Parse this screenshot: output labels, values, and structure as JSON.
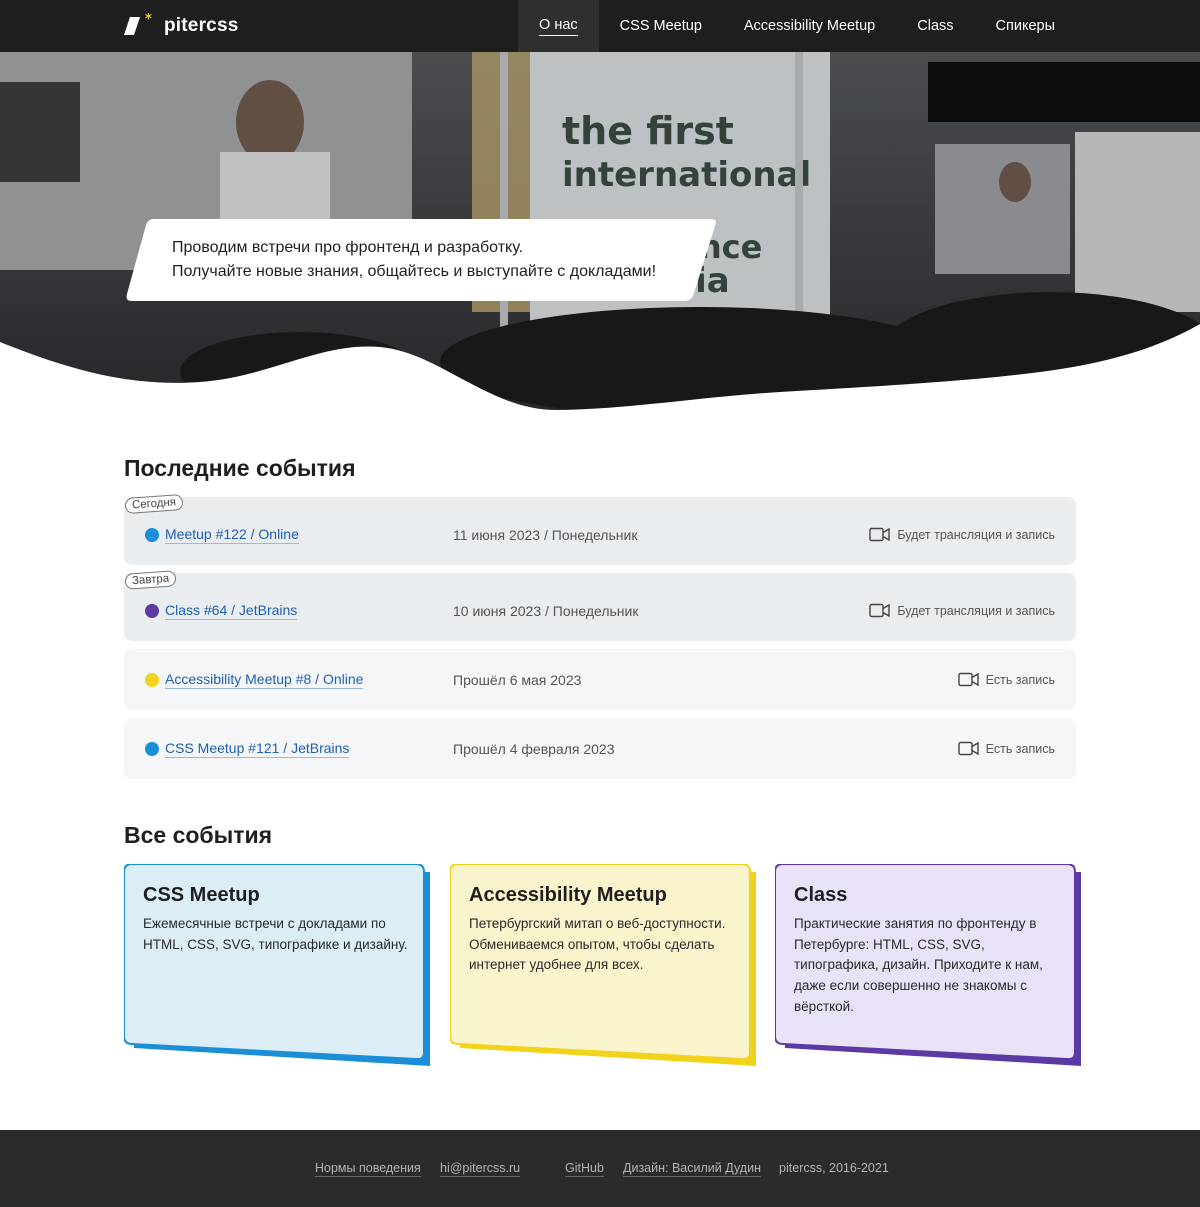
{
  "brand": {
    "name": "pitercss"
  },
  "nav": {
    "items": [
      {
        "label": "О нас"
      },
      {
        "label": "CSS Meetup"
      },
      {
        "label": "Accessibility Meetup"
      },
      {
        "label": "Class"
      },
      {
        "label": "Спикеры"
      }
    ],
    "active": "О нас"
  },
  "hero": {
    "line1": "Проводим встречи про фронтенд и разработку.",
    "line2": "Получайте новые знания, общайтесь и выступайте с докладами!"
  },
  "latest": {
    "heading": "Последние события",
    "events": [
      {
        "tag": "Сегодня",
        "title": "Meetup #122 / Online",
        "date": "11 июня 2023 / Понедельник",
        "note": "Будет трансляция и запись",
        "color": "#1a8fd8"
      },
      {
        "tag": "Завтра",
        "title": "Class #64 / JetBrains",
        "date": "10 июня 2023 / Понедельник",
        "note": "Будет трансляция и запись",
        "color": "#5b3aa3"
      },
      {
        "tag": "",
        "title": "Accessibility Meetup #8 / Online",
        "date": "Прошёл 6 мая 2023",
        "note": "Есть запись",
        "color": "#f2d31b"
      },
      {
        "tag": "",
        "title": "CSS Meetup #121 / JetBrains",
        "date": "Прошёл 4 февраля 2023",
        "note": "Есть запись",
        "color": "#1a8fd8"
      }
    ]
  },
  "all": {
    "heading": "Все события",
    "cards": [
      {
        "title": "CSS Meetup",
        "text": "Ежемесячные встречи с докладами по HTML, CSS, SVG, типографике и дизайну.",
        "accent": "#1a8fd8",
        "bg": "#dcedf6"
      },
      {
        "title": "Accessibility Meetup",
        "text": "Петербургский митап о веб-доступности. Обмениваемся опытом, чтобы сделать интернет удобнее для всех.",
        "accent": "#f2d31b",
        "bg": "#faf4cc"
      },
      {
        "title": "Class",
        "text": "Практические занятия по фронтенду в Петербурге: HTML, CSS, SVG, типографика, дизайн. Приходите к нам, даже если совершенно не знакомы с вёрсткой.",
        "accent": "#5b3aa3",
        "bg": "#e9e2f6"
      }
    ]
  },
  "footer": {
    "rules": "Нормы поведения",
    "email": "hi@pitercss.ru",
    "github": "GitHub",
    "design": "Дизайн: Василий Дудин",
    "copyright": "pitercss, 2016-2021"
  }
}
